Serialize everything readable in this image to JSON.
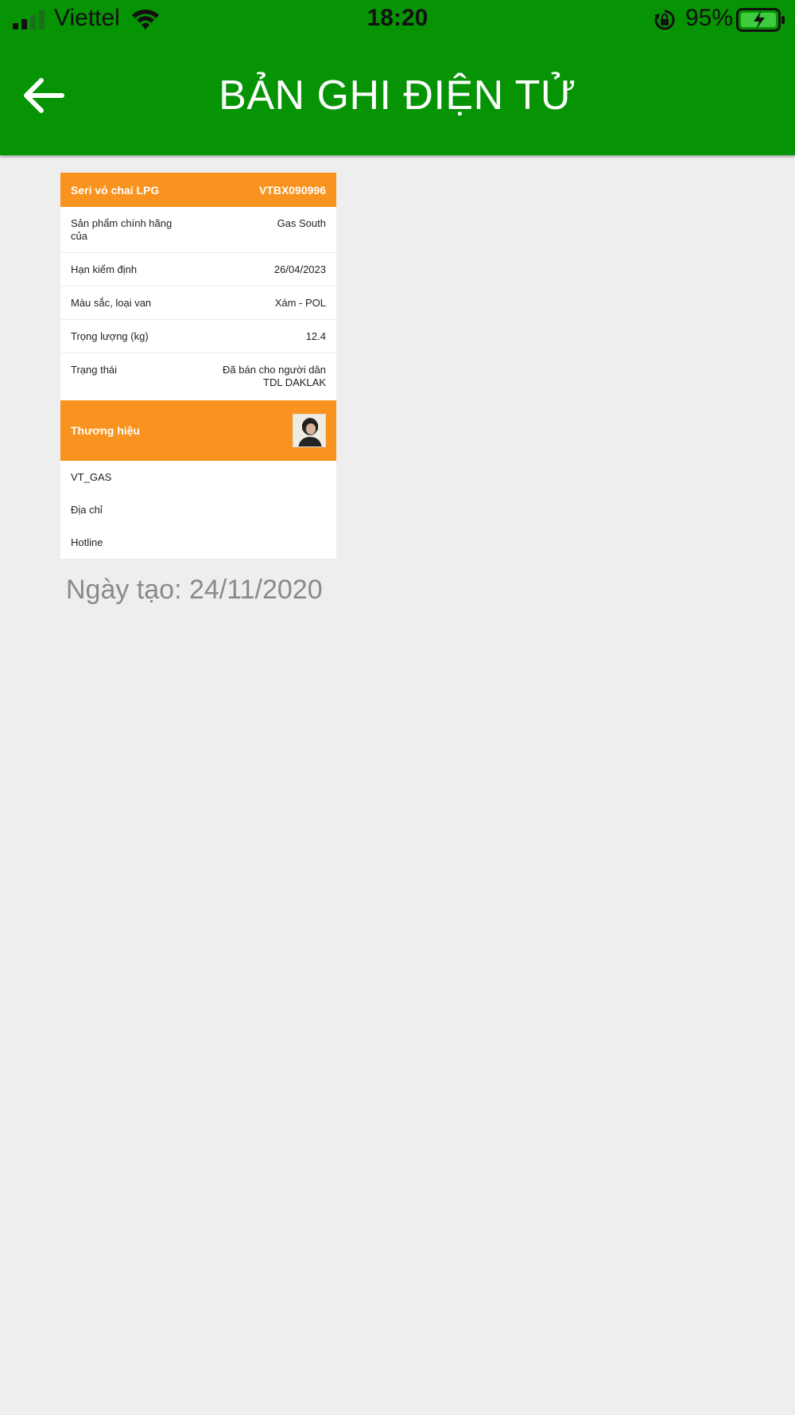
{
  "status_bar": {
    "carrier": "Viettel",
    "time": "18:20",
    "battery_percent": "95%",
    "icons": [
      "signal-icon",
      "wifi-icon",
      "orientation-lock-icon",
      "battery-charging-icon"
    ]
  },
  "header": {
    "title": "BẢN GHI ĐIỆN TỬ",
    "back_icon": "arrow-left-icon",
    "background_color": "#069404"
  },
  "card": {
    "accent_color": "#f7931e",
    "serial": {
      "label": "Seri vỏ chai LPG",
      "value": "VTBX090996"
    },
    "details": {
      "product": {
        "label": "Sản phẩm chính hãng của",
        "value": "Gas South"
      },
      "inspection": {
        "label": "Hạn kiểm định",
        "value": "26/04/2023"
      },
      "color_valve": {
        "label": "Màu sắc, loại van",
        "value": "Xám - POL"
      },
      "weight": {
        "label": "Trọng lượng (kg)",
        "value": "12.4"
      },
      "status": {
        "label": "Trạng thái",
        "value_line1": "Đã bán cho người dân",
        "value_line2": "TDL DAKLAK"
      }
    },
    "brand": {
      "label": "Thương hiệu",
      "name": "VT_GAS",
      "address_label": "Địa chỉ",
      "hotline_label": "Hotline"
    }
  },
  "created": {
    "text": "Ngày tạo: 24/11/2020"
  }
}
